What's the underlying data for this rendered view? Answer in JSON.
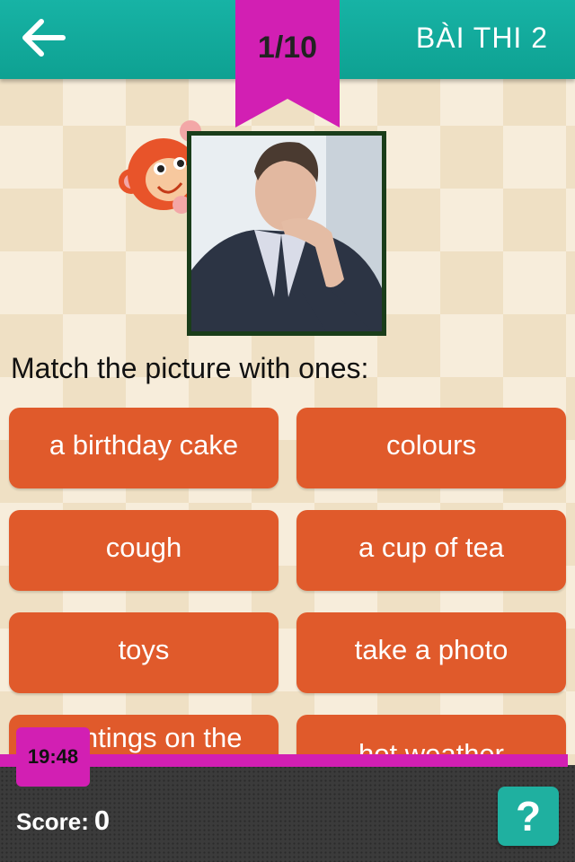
{
  "header": {
    "back_icon": "back-arrow-icon",
    "progress": "1/10",
    "title": "BÀI THI 2",
    "colors": {
      "bar": "#12a89a",
      "ribbon": "#d21fb3"
    }
  },
  "question": {
    "mascot_icon": "monkey-icon",
    "image": "photo-of-man-coughing",
    "prompt": "Match the picture with ones:"
  },
  "options": [
    "a birthday cake",
    "colours",
    "cough",
    "a cup of tea",
    "toys",
    "take a photo",
    "paintings on the",
    "hot weather"
  ],
  "footer": {
    "timer": "19:48",
    "score_label": "Score:",
    "score_value": "0",
    "help_label": "?"
  },
  "colors": {
    "option": "#e05a2b",
    "accent": "#d21fb3",
    "teal": "#12a89a"
  }
}
